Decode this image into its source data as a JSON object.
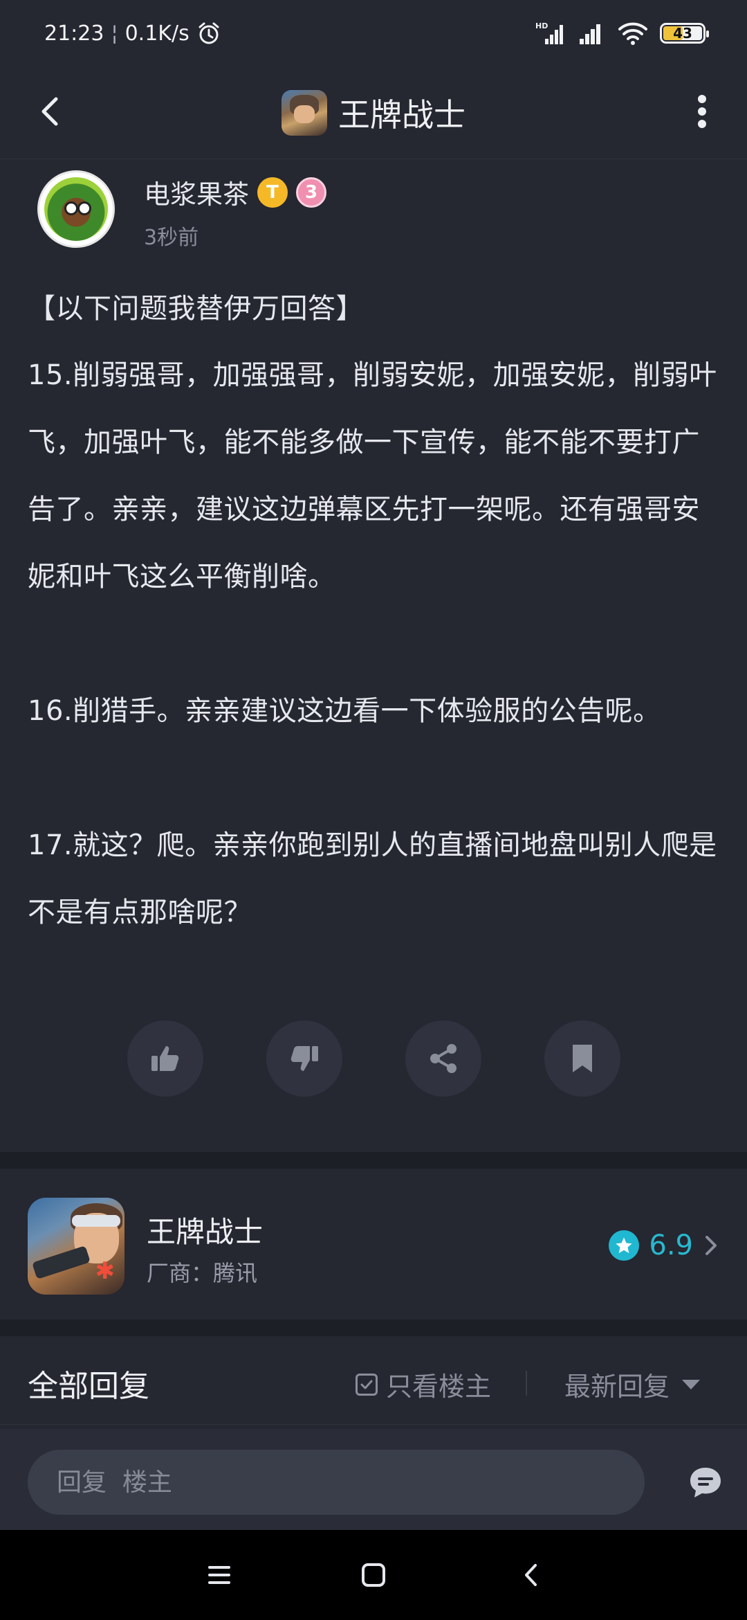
{
  "status_bar": {
    "time": "21:23",
    "separator": "¦",
    "net_speed": "0.1K/s",
    "network_label": "HD",
    "battery_level": "43"
  },
  "header": {
    "title": "王牌战士"
  },
  "post": {
    "author_name": "电浆果茶",
    "badge_t": "T",
    "badge_level": "3",
    "time_ago": "3秒前",
    "heading": "【以下问题我替伊万回答】",
    "paragraphs": [
      "15.削弱强哥，加强强哥，削弱安妮，加强安妮，削弱叶飞，加强叶飞，能不能多做一下宣传，能不能不要打广告了。亲亲，建议这边弹幕区先打一架呢。还有强哥安妮和叶飞这么平衡削啥。",
      "16.削猎手。亲亲建议这边看一下体验服的公告呢。",
      "17.就这？爬。亲亲你跑到别人的直播间地盘叫别人爬是不是有点那啥呢？"
    ]
  },
  "game_card": {
    "name": "王牌战士",
    "vendor": "厂商：腾讯",
    "rating": "6.9"
  },
  "replies": {
    "title": "全部回复",
    "only_op_label": "只看楼主",
    "sort_label": "最新回复"
  },
  "reply_bar": {
    "placeholder": "回复  楼主"
  },
  "colors": {
    "background": "#252731",
    "accent": "#20b8d0",
    "badge_gold": "#f5b928",
    "badge_pink": "#f08fb0"
  }
}
